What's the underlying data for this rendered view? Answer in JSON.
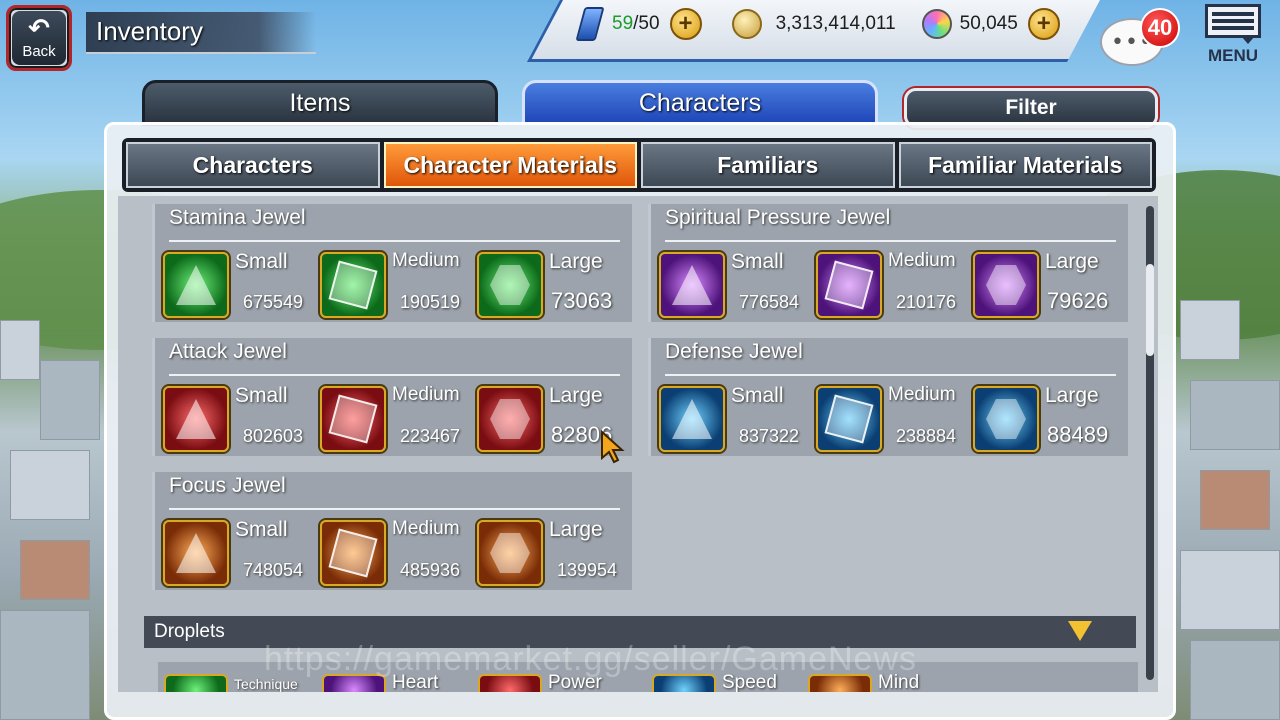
{
  "header": {
    "back_label": "Back",
    "title": "Inventory"
  },
  "resources": {
    "stamina_current": "59",
    "stamina_max": "/50",
    "coins": "3,313,414,011",
    "orbs": "50,045"
  },
  "notifications": {
    "count": "40"
  },
  "menu": {
    "label": "MENU"
  },
  "main_tabs": [
    {
      "label": "Items"
    },
    {
      "label": "Characters"
    }
  ],
  "filter_label": "Filter",
  "sub_tabs": [
    {
      "label": "Characters"
    },
    {
      "label": "Character Materials"
    },
    {
      "label": "Familiars"
    },
    {
      "label": "Familiar Materials"
    }
  ],
  "jewels": [
    {
      "title": "Stamina Jewel",
      "color": "#1aa32e",
      "items": [
        {
          "size": "Small",
          "count": "675549"
        },
        {
          "size": "Medium",
          "count": "190519"
        },
        {
          "size": "Large",
          "count": "73063"
        }
      ]
    },
    {
      "title": "Spiritual Pressure Jewel",
      "color": "#8a2fc2",
      "items": [
        {
          "size": "Small",
          "count": "776584"
        },
        {
          "size": "Medium",
          "count": "210176"
        },
        {
          "size": "Large",
          "count": "79626"
        }
      ]
    },
    {
      "title": "Attack Jewel",
      "color": "#c2202a",
      "items": [
        {
          "size": "Small",
          "count": "802603"
        },
        {
          "size": "Medium",
          "count": "223467"
        },
        {
          "size": "Large",
          "count": "82806"
        }
      ]
    },
    {
      "title": "Defense Jewel",
      "color": "#1f7fc4",
      "items": [
        {
          "size": "Small",
          "count": "837322"
        },
        {
          "size": "Medium",
          "count": "238884"
        },
        {
          "size": "Large",
          "count": "88489"
        }
      ]
    },
    {
      "title": "Focus Jewel",
      "color": "#d0610f",
      "items": [
        {
          "size": "Small",
          "count": "748054"
        },
        {
          "size": "Medium",
          "count": "485936"
        },
        {
          "size": "Large",
          "count": "139954"
        }
      ]
    }
  ],
  "droplets": {
    "title": "Droplets",
    "items": [
      {
        "label": "Technique"
      },
      {
        "label": "Heart"
      },
      {
        "label": "Power"
      },
      {
        "label": "Speed"
      },
      {
        "label": "Mind"
      }
    ]
  },
  "watermark": "https://gamemarket.gg/seller/GameNews"
}
